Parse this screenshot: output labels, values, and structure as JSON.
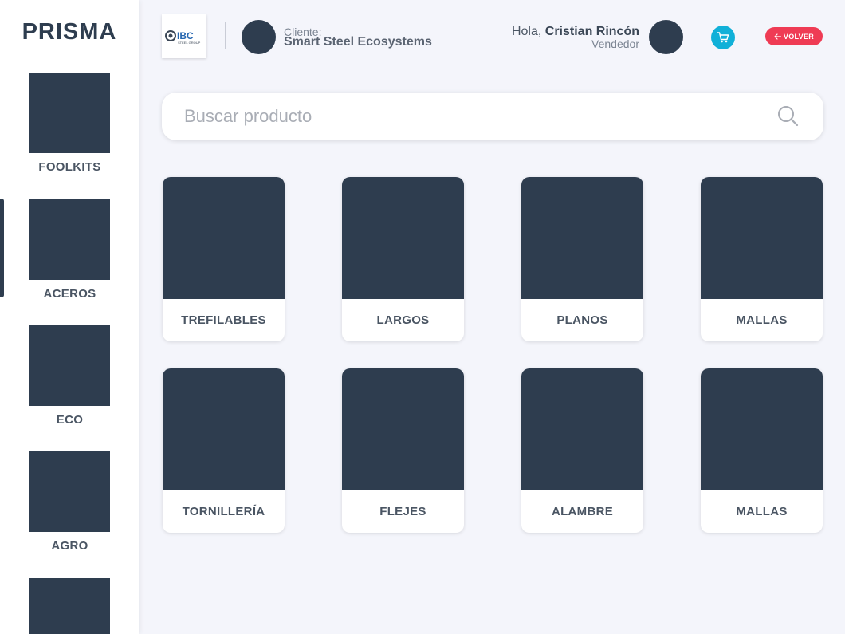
{
  "brand": "PRISMA",
  "sidebar": {
    "items": [
      {
        "label": "FOOLKITS"
      },
      {
        "label": "ACEROS"
      },
      {
        "label": "ECO"
      },
      {
        "label": "AGRO"
      },
      {
        "label": ""
      }
    ],
    "active_index": 1
  },
  "header": {
    "logo_text": "IBC",
    "logo_subtext": "STEEL GROUP",
    "client_caption": "Cliente:",
    "client_name": "Smart Steel Ecosystems",
    "greeting": "Hola,",
    "user_name": "Cristian Rincón",
    "user_role": "Vendedor",
    "back_label": "VOLVER"
  },
  "search": {
    "placeholder": "Buscar producto",
    "value": ""
  },
  "categories": [
    {
      "label": "TREFILABLES"
    },
    {
      "label": "LARGOS"
    },
    {
      "label": "PLANOS"
    },
    {
      "label": "MALLAS"
    },
    {
      "label": "TORNILLERÍA"
    },
    {
      "label": "FLEJES"
    },
    {
      "label": "ALAMBRE"
    },
    {
      "label": "MALLAS"
    }
  ],
  "colors": {
    "primary_dark": "#2e3d4f",
    "cart_accent": "#11b0d8",
    "back_accent": "#ef3b54",
    "background": "#f4f5fb"
  },
  "icons": {
    "cart": "shopping-cart-icon",
    "search": "search-icon",
    "back": "arrow-left-icon"
  }
}
